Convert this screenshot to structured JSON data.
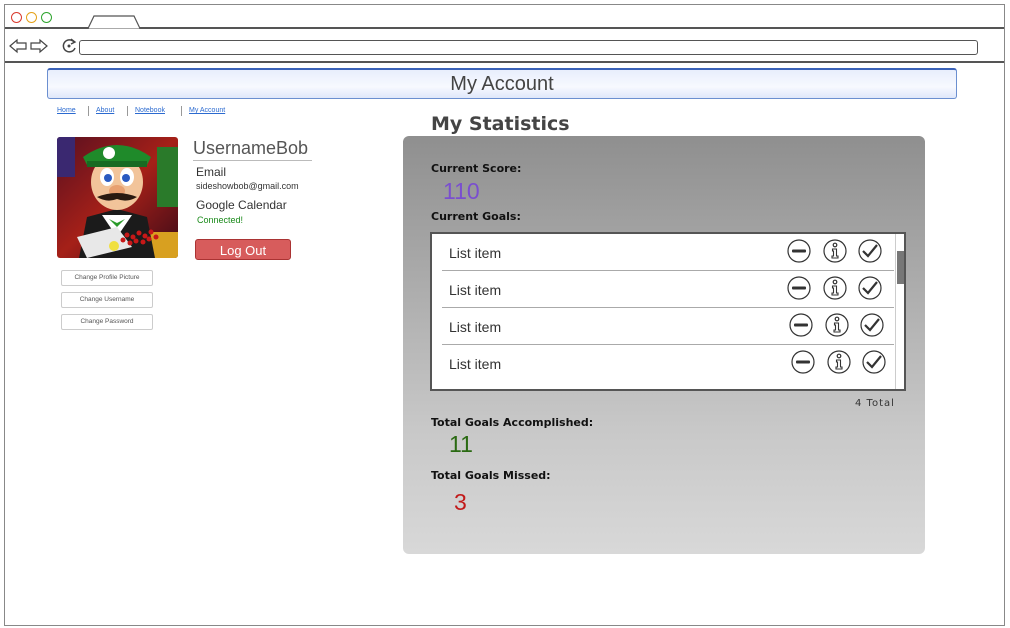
{
  "browser": {
    "url": ""
  },
  "page": {
    "title": "My Account"
  },
  "nav": {
    "home": "Home",
    "about": "About",
    "notebook": "Notebook",
    "my_account": "My Account"
  },
  "profile": {
    "username": "UsernameBob",
    "email_label": "Email",
    "email_value": "sideshowbob@gmail.com",
    "calendar_label": "Google Calendar",
    "calendar_status": "Connected!",
    "logout_label": "Log Out",
    "change_picture": "Change Profile Picture",
    "change_username": "Change Username",
    "change_password": "Change Password"
  },
  "stats": {
    "title": "My Statistics",
    "current_score_label": "Current Score:",
    "current_score": "110",
    "current_goals_label": "Current Goals:",
    "goals": [
      {
        "label": "List item"
      },
      {
        "label": "List item"
      },
      {
        "label": "List item"
      },
      {
        "label": "List item"
      }
    ],
    "total_count": "4 Total",
    "accomplished_label": "Total Goals Accomplished:",
    "accomplished": "11",
    "missed_label": "Total Goals Missed:",
    "missed": "3"
  },
  "colors": {
    "score": "#7a4fcf",
    "accomplished": "#2a6a12",
    "missed": "#c21a1a",
    "logout": "#d75c5c",
    "calendar_status": "#1a8a1a"
  }
}
